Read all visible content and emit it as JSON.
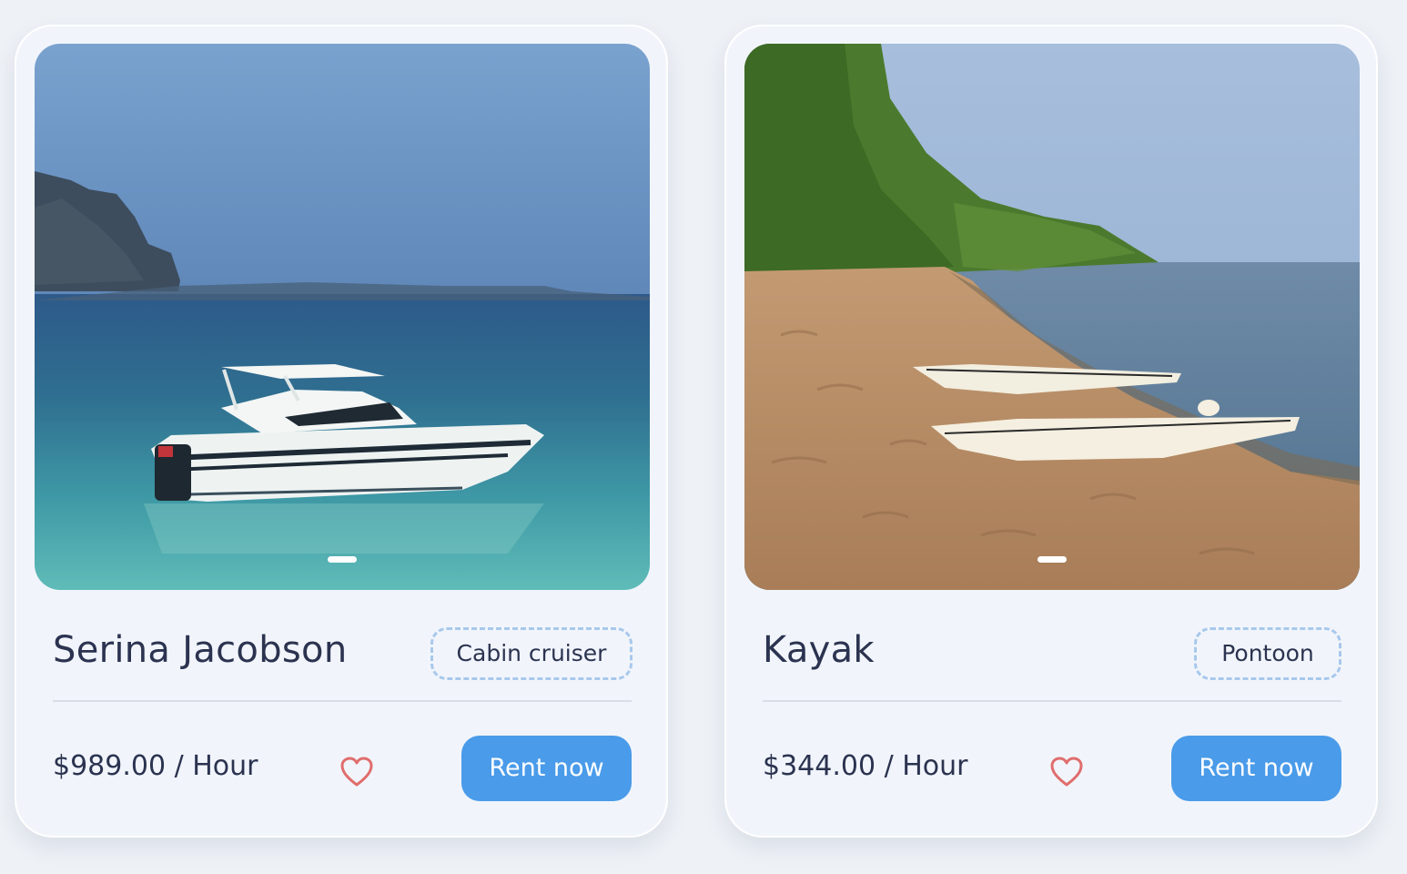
{
  "cards": [
    {
      "title": "Serina Jacobson",
      "tag": "Cabin cruiser",
      "price": "$989.00 / Hour",
      "button": "Rent now",
      "image_icon": "boat-photo"
    },
    {
      "title": "Kayak",
      "tag": "Pontoon",
      "price": "$344.00 / Hour",
      "button": "Rent now",
      "image_icon": "kayak-photo"
    }
  ],
  "colors": {
    "accent": "#4a9be9",
    "heart": "#e06d6d",
    "tag_border": "#a8c8ec",
    "text": "#2b3350"
  }
}
